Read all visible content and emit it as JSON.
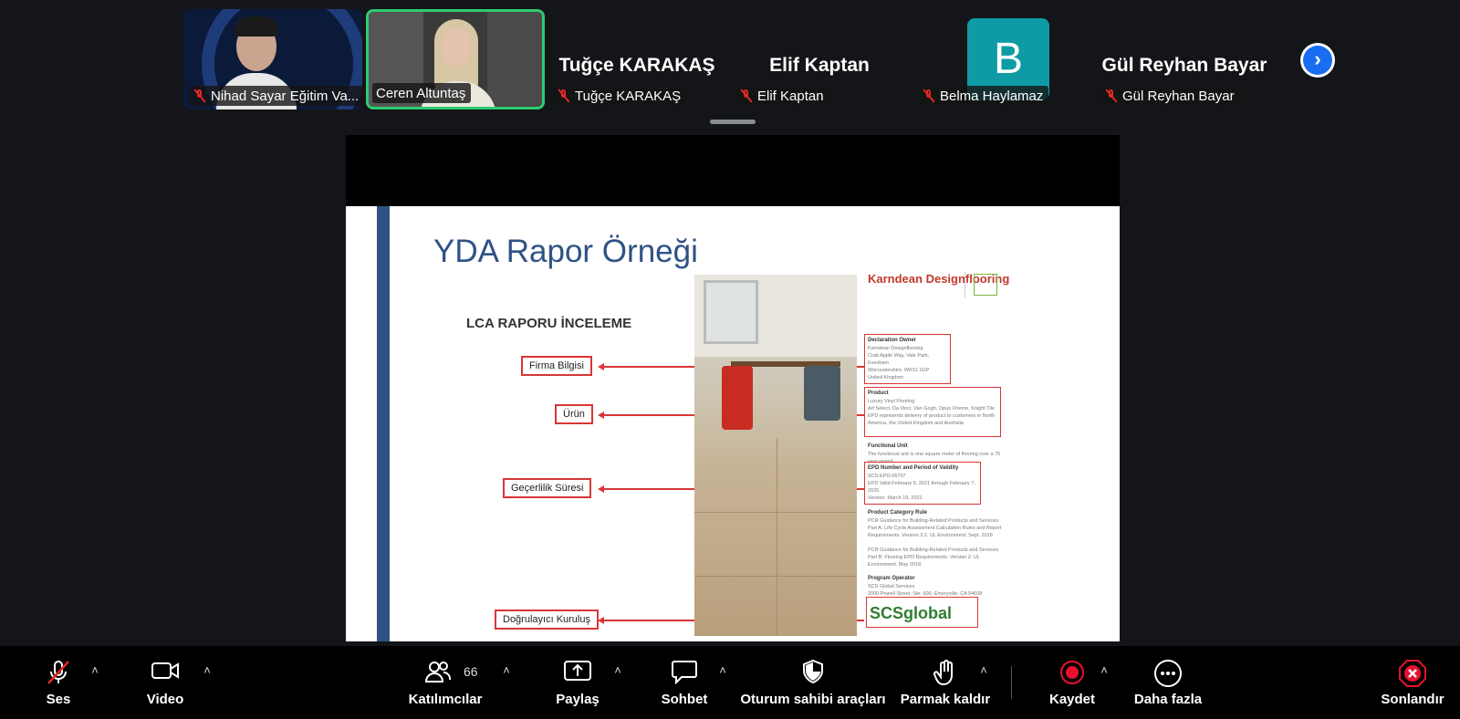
{
  "participants": {
    "video_tiles": [
      {
        "name": "Nihad Sayar Eğitim Va..."
      },
      {
        "name": "Ceren Altuntaş"
      }
    ],
    "name_tiles": [
      {
        "display_name": "Tuğçe KARAKAŞ",
        "label": "Tuğçe KARAKAŞ"
      },
      {
        "display_name": "Elif Kaptan",
        "label": "Elif Kaptan"
      },
      {
        "avatar_letter": "B",
        "label": "Belma Haylamaz"
      },
      {
        "display_name": "Gül Reyhan Bayar",
        "label": "Gül Reyhan Bayar"
      }
    ],
    "next_icon": "chevron-right-icon"
  },
  "slide": {
    "title": "YDA Rapor Örneği",
    "subtitle": "LCA RAPORU İNCELEME",
    "callouts": [
      "Firma Bilgisi",
      "Ürün",
      "Geçerlilik Süresi",
      "Doğrulayıcı Kuruluş"
    ],
    "doc": {
      "logo": "Karndean Designflooring",
      "declaration_heading": "Declaration Owner",
      "declaration_text": "Karndean Designflooring\nCrab Apple Way, Vale Park, Evesham\nWorcestershire, WR11 1GP\nUnited Kingdom\nwww.karndean.com",
      "product_heading": "Product",
      "product_text": "Luxury Vinyl Flooring\nArt Select, Da Vinci, Van Gogh, Opus Xtreme, Knight Tile\nEPD represents delivery of product to customers in North\nAmerica, the United Kingdom and Australia",
      "functional_heading": "Functional Unit",
      "functional_text": "The functional unit is one square meter of flooring over a 75 year period",
      "epd_heading": "EPD Number and Period of Validity",
      "epd_text": "SCS-EPD-06707\nEPD Valid February 8, 2021 through February 7, 2026\nVersion: March 19, 2021",
      "pcr_heading": "Product Category Rule",
      "pcr_text": "PCR Guidance for Building-Related Products and Services Part A: Life Cycle Assessment Calculation Rules and Report Requirements. Version 3.2. UL Environment. Sept. 2018\n\nPCR Guidance for Building-Related Products and Services Part B: Flooring EPD Requirements. Version 2. UL Environment. May 2018",
      "operator_heading": "Program Operator",
      "operator_text": "SCS Global Services\n2000 Powell Street, Ste. 600, Emeryville, CA 94608\n+1.510.452.8000 | www.SCSglobalServices.com",
      "verifier_logo": "SCSglobal"
    }
  },
  "toolbar": {
    "audio_label": "Ses",
    "video_label": "Video",
    "participants_label": "Katılımcılar",
    "participants_count": "66",
    "share_label": "Paylaş",
    "chat_label": "Sohbet",
    "host_tools_label": "Oturum sahibi araçları",
    "raise_hand_label": "Parmak kaldır",
    "record_label": "Kaydet",
    "more_label": "Daha fazla",
    "end_label": "Sonlandır"
  },
  "colors": {
    "mute_red": "#e02828",
    "active_speaker": "#2ecc71",
    "slide_blue": "#2f5284",
    "callout_red": "#d93636",
    "avatar_teal": "#0f9ba6",
    "record_red": "#e8112d"
  }
}
